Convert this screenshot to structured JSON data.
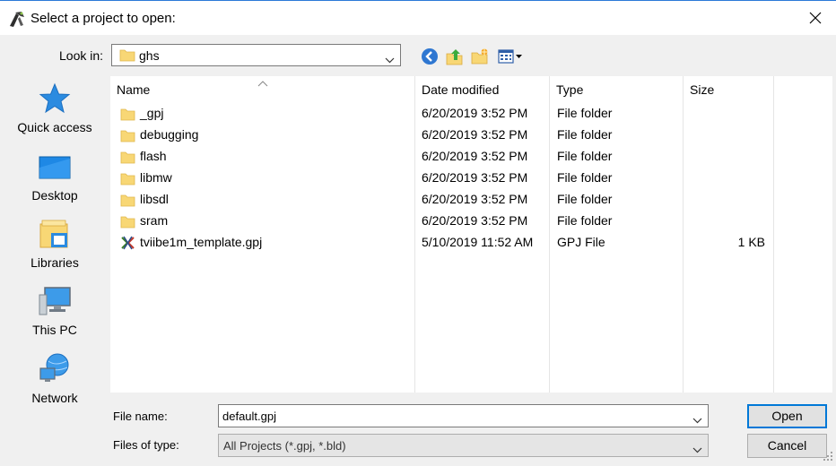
{
  "window": {
    "title": "Select a project to open:"
  },
  "look_in": {
    "label": "Look in:",
    "value": "ghs"
  },
  "toolbar": {
    "icons": [
      "back-icon",
      "up-folder-icon",
      "new-folder-icon",
      "view-menu-icon"
    ]
  },
  "places": [
    {
      "label": "Quick access",
      "icon": "star-icon"
    },
    {
      "label": "Desktop",
      "icon": "desktop-icon"
    },
    {
      "label": "Libraries",
      "icon": "libraries-icon"
    },
    {
      "label": "This PC",
      "icon": "computer-icon"
    },
    {
      "label": "Network",
      "icon": "network-icon"
    }
  ],
  "columns": {
    "name": "Name",
    "date": "Date modified",
    "type": "Type",
    "size": "Size"
  },
  "files": [
    {
      "name": "_gpj",
      "date": "6/20/2019 3:52 PM",
      "type": "File folder",
      "size": "",
      "icon": "folder-icon"
    },
    {
      "name": "debugging",
      "date": "6/20/2019 3:52 PM",
      "type": "File folder",
      "size": "",
      "icon": "folder-icon"
    },
    {
      "name": "flash",
      "date": "6/20/2019 3:52 PM",
      "type": "File folder",
      "size": "",
      "icon": "folder-icon"
    },
    {
      "name": "libmw",
      "date": "6/20/2019 3:52 PM",
      "type": "File folder",
      "size": "",
      "icon": "folder-icon"
    },
    {
      "name": "libsdl",
      "date": "6/20/2019 3:52 PM",
      "type": "File folder",
      "size": "",
      "icon": "folder-icon"
    },
    {
      "name": "sram",
      "date": "6/20/2019 3:52 PM",
      "type": "File folder",
      "size": "",
      "icon": "folder-icon"
    },
    {
      "name": "tviibe1m_template.gpj",
      "date": "5/10/2019 11:52 AM",
      "type": "GPJ File",
      "size": "1 KB",
      "icon": "gpj-file-icon"
    }
  ],
  "file_name": {
    "label": "File name:",
    "value": "default.gpj"
  },
  "file_type": {
    "label": "Files of type:",
    "value": "All Projects (*.gpj, *.bld)"
  },
  "buttons": {
    "open": "Open",
    "cancel": "Cancel"
  },
  "colors": {
    "accent": "#0078d7",
    "folder": "#f8d775",
    "selection_border": "#2b79d7"
  }
}
